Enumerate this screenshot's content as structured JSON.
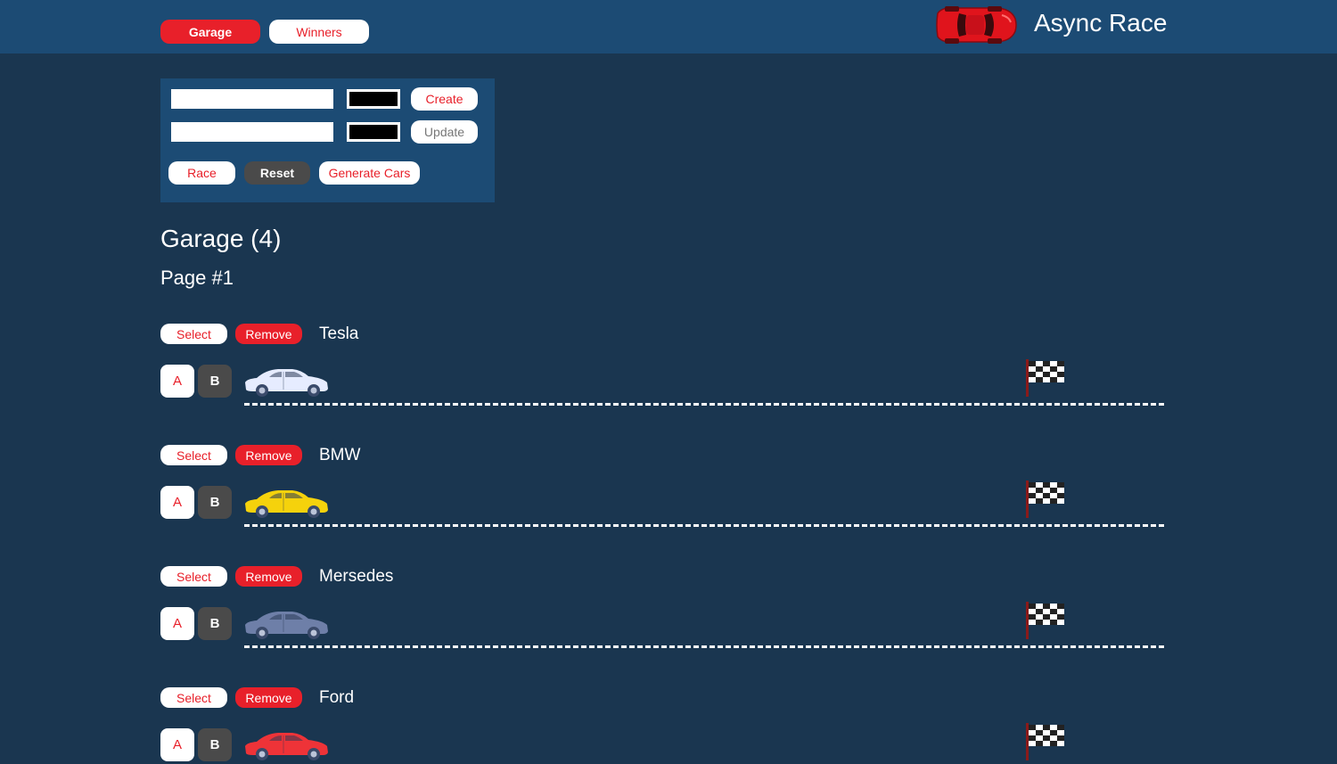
{
  "header": {
    "nav": [
      {
        "label": "Garage",
        "active": true
      },
      {
        "label": "Winners",
        "active": false
      }
    ],
    "title": "Async Race",
    "logo_color": "#e0141c"
  },
  "controls": {
    "create": {
      "name_value": "",
      "color_value": "#000000",
      "button_label": "Create"
    },
    "update": {
      "name_value": "",
      "color_value": "#000000",
      "button_label": "Update"
    },
    "race_label": "Race",
    "reset_label": "Reset",
    "generate_label": "Generate Cars"
  },
  "garage": {
    "title": "Garage (4)",
    "page": "Page #1"
  },
  "cars": [
    {
      "name": "Tesla",
      "color": "#e6ecff",
      "select_label": "Select",
      "remove_label": "Remove",
      "start_label": "A",
      "stop_label": "B"
    },
    {
      "name": "BMW",
      "color": "#f5d20c",
      "select_label": "Select",
      "remove_label": "Remove",
      "start_label": "A",
      "stop_label": "B"
    },
    {
      "name": "Mersedes",
      "color": "#6e7fa8",
      "select_label": "Select",
      "remove_label": "Remove",
      "start_label": "A",
      "stop_label": "B"
    },
    {
      "name": "Ford",
      "color": "#ee3338",
      "select_label": "Select",
      "remove_label": "Remove",
      "start_label": "A",
      "stop_label": "B"
    }
  ],
  "colors": {
    "accent_red": "#e8202a",
    "header_bg": "#1c4b74",
    "page_bg": "#1a3650",
    "dark_button": "#4a4a4a"
  }
}
